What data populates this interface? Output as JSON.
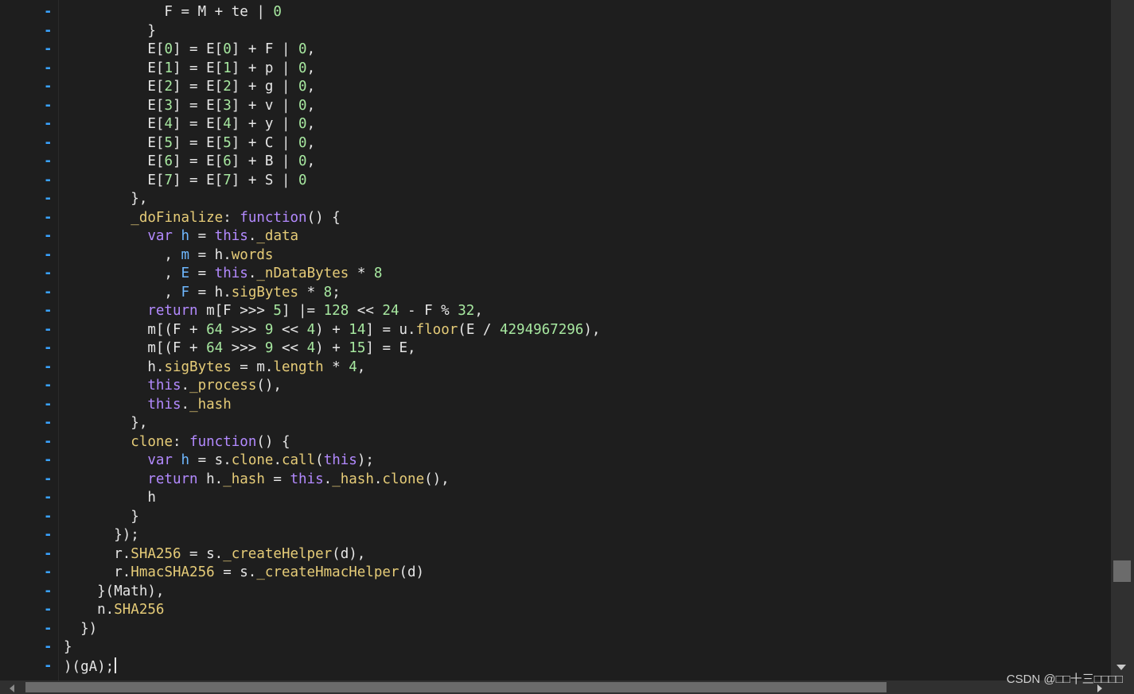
{
  "fold_marker": "-",
  "watermark": "CSDN @□□十三□□□□",
  "colors": {
    "background": "#1e1e1e",
    "default_text": "#e6e6e6",
    "number": "#a7e8a0",
    "keyword": "#b38aff",
    "property": "#e6cc78",
    "variable": "#6fb8ff",
    "fold_marker": "#3aa3ff"
  },
  "lines": [
    [
      [
        "txt",
        "            F = M + te | "
      ],
      [
        "num",
        "0"
      ]
    ],
    [
      [
        "txt",
        "          }"
      ]
    ],
    [
      [
        "txt",
        "          E["
      ],
      [
        "num",
        "0"
      ],
      [
        "txt",
        "] = E["
      ],
      [
        "num",
        "0"
      ],
      [
        "txt",
        "] + F | "
      ],
      [
        "num",
        "0"
      ],
      [
        "txt",
        ","
      ]
    ],
    [
      [
        "txt",
        "          E["
      ],
      [
        "num",
        "1"
      ],
      [
        "txt",
        "] = E["
      ],
      [
        "num",
        "1"
      ],
      [
        "txt",
        "] + p | "
      ],
      [
        "num",
        "0"
      ],
      [
        "txt",
        ","
      ]
    ],
    [
      [
        "txt",
        "          E["
      ],
      [
        "num",
        "2"
      ],
      [
        "txt",
        "] = E["
      ],
      [
        "num",
        "2"
      ],
      [
        "txt",
        "] + g | "
      ],
      [
        "num",
        "0"
      ],
      [
        "txt",
        ","
      ]
    ],
    [
      [
        "txt",
        "          E["
      ],
      [
        "num",
        "3"
      ],
      [
        "txt",
        "] = E["
      ],
      [
        "num",
        "3"
      ],
      [
        "txt",
        "] + v | "
      ],
      [
        "num",
        "0"
      ],
      [
        "txt",
        ","
      ]
    ],
    [
      [
        "txt",
        "          E["
      ],
      [
        "num",
        "4"
      ],
      [
        "txt",
        "] = E["
      ],
      [
        "num",
        "4"
      ],
      [
        "txt",
        "] + y | "
      ],
      [
        "num",
        "0"
      ],
      [
        "txt",
        ","
      ]
    ],
    [
      [
        "txt",
        "          E["
      ],
      [
        "num",
        "5"
      ],
      [
        "txt",
        "] = E["
      ],
      [
        "num",
        "5"
      ],
      [
        "txt",
        "] + C | "
      ],
      [
        "num",
        "0"
      ],
      [
        "txt",
        ","
      ]
    ],
    [
      [
        "txt",
        "          E["
      ],
      [
        "num",
        "6"
      ],
      [
        "txt",
        "] = E["
      ],
      [
        "num",
        "6"
      ],
      [
        "txt",
        "] + B | "
      ],
      [
        "num",
        "0"
      ],
      [
        "txt",
        ","
      ]
    ],
    [
      [
        "txt",
        "          E["
      ],
      [
        "num",
        "7"
      ],
      [
        "txt",
        "] = E["
      ],
      [
        "num",
        "7"
      ],
      [
        "txt",
        "] + S | "
      ],
      [
        "num",
        "0"
      ]
    ],
    [
      [
        "txt",
        "        },"
      ]
    ],
    [
      [
        "txt",
        "        "
      ],
      [
        "prop",
        "_doFinalize"
      ],
      [
        "txt",
        ": "
      ],
      [
        "kw",
        "function"
      ],
      [
        "txt",
        "() {"
      ]
    ],
    [
      [
        "txt",
        "          "
      ],
      [
        "kw",
        "var"
      ],
      [
        "txt",
        " "
      ],
      [
        "var",
        "h"
      ],
      [
        "txt",
        " = "
      ],
      [
        "kw",
        "this"
      ],
      [
        "txt",
        "."
      ],
      [
        "prop",
        "_data"
      ]
    ],
    [
      [
        "txt",
        "            , "
      ],
      [
        "var",
        "m"
      ],
      [
        "txt",
        " = h."
      ],
      [
        "prop",
        "words"
      ]
    ],
    [
      [
        "txt",
        "            , "
      ],
      [
        "var",
        "E"
      ],
      [
        "txt",
        " = "
      ],
      [
        "kw",
        "this"
      ],
      [
        "txt",
        "."
      ],
      [
        "prop",
        "_nDataBytes"
      ],
      [
        "txt",
        " * "
      ],
      [
        "num",
        "8"
      ]
    ],
    [
      [
        "txt",
        "            , "
      ],
      [
        "var",
        "F"
      ],
      [
        "txt",
        " = h."
      ],
      [
        "prop",
        "sigBytes"
      ],
      [
        "txt",
        " * "
      ],
      [
        "num",
        "8"
      ],
      [
        "txt",
        ";"
      ]
    ],
    [
      [
        "txt",
        "          "
      ],
      [
        "kw",
        "return"
      ],
      [
        "txt",
        " m[F >>> "
      ],
      [
        "num",
        "5"
      ],
      [
        "txt",
        "] |= "
      ],
      [
        "num",
        "128"
      ],
      [
        "txt",
        " << "
      ],
      [
        "num",
        "24"
      ],
      [
        "txt",
        " - F % "
      ],
      [
        "num",
        "32"
      ],
      [
        "txt",
        ","
      ]
    ],
    [
      [
        "txt",
        "          m[(F + "
      ],
      [
        "num",
        "64"
      ],
      [
        "txt",
        " >>> "
      ],
      [
        "num",
        "9"
      ],
      [
        "txt",
        " << "
      ],
      [
        "num",
        "4"
      ],
      [
        "txt",
        ") + "
      ],
      [
        "num",
        "14"
      ],
      [
        "txt",
        "] = u."
      ],
      [
        "prop",
        "floor"
      ],
      [
        "txt",
        "(E / "
      ],
      [
        "num",
        "4294967296"
      ],
      [
        "txt",
        "),"
      ]
    ],
    [
      [
        "txt",
        "          m[(F + "
      ],
      [
        "num",
        "64"
      ],
      [
        "txt",
        " >>> "
      ],
      [
        "num",
        "9"
      ],
      [
        "txt",
        " << "
      ],
      [
        "num",
        "4"
      ],
      [
        "txt",
        ") + "
      ],
      [
        "num",
        "15"
      ],
      [
        "txt",
        "] = E,"
      ]
    ],
    [
      [
        "txt",
        "          h."
      ],
      [
        "prop",
        "sigBytes"
      ],
      [
        "txt",
        " = m."
      ],
      [
        "prop",
        "length"
      ],
      [
        "txt",
        " * "
      ],
      [
        "num",
        "4"
      ],
      [
        "txt",
        ","
      ]
    ],
    [
      [
        "txt",
        "          "
      ],
      [
        "kw",
        "this"
      ],
      [
        "txt",
        "."
      ],
      [
        "prop",
        "_process"
      ],
      [
        "txt",
        "(),"
      ]
    ],
    [
      [
        "txt",
        "          "
      ],
      [
        "kw",
        "this"
      ],
      [
        "txt",
        "."
      ],
      [
        "prop",
        "_hash"
      ]
    ],
    [
      [
        "txt",
        "        },"
      ]
    ],
    [
      [
        "txt",
        "        "
      ],
      [
        "prop",
        "clone"
      ],
      [
        "txt",
        ": "
      ],
      [
        "kw",
        "function"
      ],
      [
        "txt",
        "() {"
      ]
    ],
    [
      [
        "txt",
        "          "
      ],
      [
        "kw",
        "var"
      ],
      [
        "txt",
        " "
      ],
      [
        "var",
        "h"
      ],
      [
        "txt",
        " = s."
      ],
      [
        "prop",
        "clone"
      ],
      [
        "txt",
        "."
      ],
      [
        "prop",
        "call"
      ],
      [
        "txt",
        "("
      ],
      [
        "kw",
        "this"
      ],
      [
        "txt",
        ");"
      ]
    ],
    [
      [
        "txt",
        "          "
      ],
      [
        "kw",
        "return"
      ],
      [
        "txt",
        " h."
      ],
      [
        "prop",
        "_hash"
      ],
      [
        "txt",
        " = "
      ],
      [
        "kw",
        "this"
      ],
      [
        "txt",
        "."
      ],
      [
        "prop",
        "_hash"
      ],
      [
        "txt",
        "."
      ],
      [
        "prop",
        "clone"
      ],
      [
        "txt",
        "(),"
      ]
    ],
    [
      [
        "txt",
        "          h"
      ]
    ],
    [
      [
        "txt",
        "        }"
      ]
    ],
    [
      [
        "txt",
        "      });"
      ]
    ],
    [
      [
        "txt",
        "      r."
      ],
      [
        "prop",
        "SHA256"
      ],
      [
        "txt",
        " = s."
      ],
      [
        "prop",
        "_createHelper"
      ],
      [
        "txt",
        "(d),"
      ]
    ],
    [
      [
        "txt",
        "      r."
      ],
      [
        "prop",
        "HmacSHA256"
      ],
      [
        "txt",
        " = s."
      ],
      [
        "prop",
        "_createHmacHelper"
      ],
      [
        "txt",
        "(d)"
      ]
    ],
    [
      [
        "txt",
        "    }(Math),"
      ]
    ],
    [
      [
        "txt",
        "    n."
      ],
      [
        "prop",
        "SHA256"
      ]
    ],
    [
      [
        "txt",
        "  })"
      ]
    ],
    [
      [
        "txt",
        "}"
      ]
    ],
    [
      [
        "txt",
        ")(gA);"
      ]
    ]
  ]
}
